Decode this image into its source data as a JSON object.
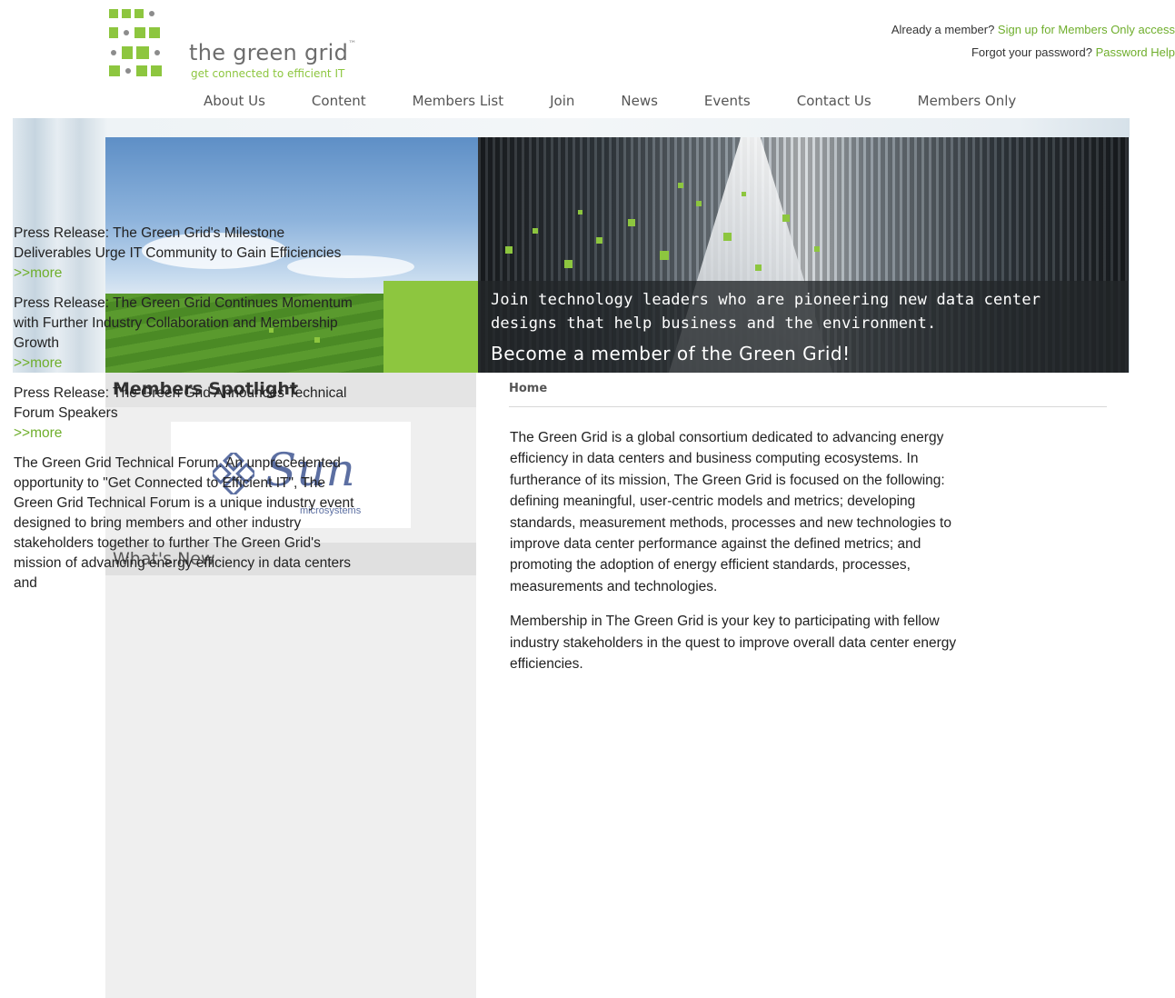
{
  "brand": {
    "name": "the green grid",
    "trademark": "™",
    "tagline": "get connected to efficient IT",
    "accent_color": "#8dc63f"
  },
  "account": {
    "member_prompt": "Already a member? ",
    "member_link": "Sign up for Members Only access",
    "password_prompt": "Forgot your password? ",
    "password_link": "Password Help"
  },
  "nav": {
    "items": [
      "About Us",
      "Content",
      "Members List",
      "Join",
      "News",
      "Events",
      "Contact Us",
      "Members Only"
    ]
  },
  "hero": {
    "line1": "Join technology leaders who are pioneering new data center designs that help business and the environment.",
    "line2": "Become a member of the Green Grid!"
  },
  "sidebar": {
    "spotlight_title": "Members Spotlight",
    "spotlight_logo": {
      "word": "Sun",
      "sub": "microsystems",
      "color": "#5c6fa2"
    },
    "whats_new_title": "What's New",
    "news": [
      {
        "text": "Press Release: The Green Grid's Milestone Deliverables Urge IT Community to Gain Efficiencies",
        "more": ">>more"
      },
      {
        "text": "Press Release: The Green Grid Continues Momentum with Further Industry Collaboration and Membership Growth",
        "more": ">>more"
      },
      {
        "text": "Press Release: The Green Grid Announces Technical Forum Speakers",
        "more": ">>more"
      },
      {
        "text": "The Green Grid Technical Forum. An unprecedented opportunity to \"Get Connected to Efficient IT\", The Green Grid Technical Forum is a unique industry event designed to bring members and other industry stakeholders together to further The Green Grid's mission of advancing energy efficiency in data centers and"
      }
    ]
  },
  "main": {
    "breadcrumb": "Home",
    "paragraph1": "The Green Grid is a global consortium dedicated to advancing energy efficiency in data centers and business computing ecosystems.  In furtherance of its mission, The Green Grid is focused on the following: defining meaningful, user-centric models and metrics; developing standards, measurement methods, processes and new technologies to improve data center performance against the defined metrics; and promoting the adoption of energy efficient standards, processes, measurements and technologies.",
    "paragraph2": "Membership in The Green Grid is your key to participating with fellow industry stakeholders in the quest to improve overall data center energy efficiencies."
  }
}
